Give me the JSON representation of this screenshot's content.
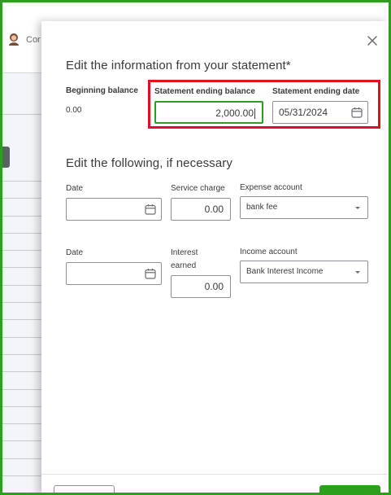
{
  "background": {
    "company_label": "Cor"
  },
  "drawer": {
    "section1_title": "Edit the information from your statement*",
    "beginning_balance": {
      "label": "Beginning balance",
      "value": "0.00"
    },
    "ending_balance": {
      "label": "Statement ending balance",
      "value": "2,000.00"
    },
    "ending_date": {
      "label": "Statement ending date",
      "value": "05/31/2024"
    },
    "section2_title": "Edit the following, if necessary",
    "service_row": {
      "date_label": "Date",
      "date_value": "",
      "amount_label": "Service charge",
      "amount_value": "0.00",
      "account_label": "Expense account",
      "account_value": "bank fee"
    },
    "interest_row": {
      "date_label": "Date",
      "date_value": "",
      "amount_label_line1": "Interest",
      "amount_label_line2": "earned",
      "amount_value": "0.00",
      "account_label": "Income account",
      "account_value": "Bank Interest Income"
    }
  },
  "colors": {
    "accent": "#2ca01c",
    "highlight": "#e0101f",
    "text": "#393a3d"
  },
  "icons": [
    "close-icon",
    "calendar-icon",
    "chevron-down-icon",
    "avatar"
  ]
}
